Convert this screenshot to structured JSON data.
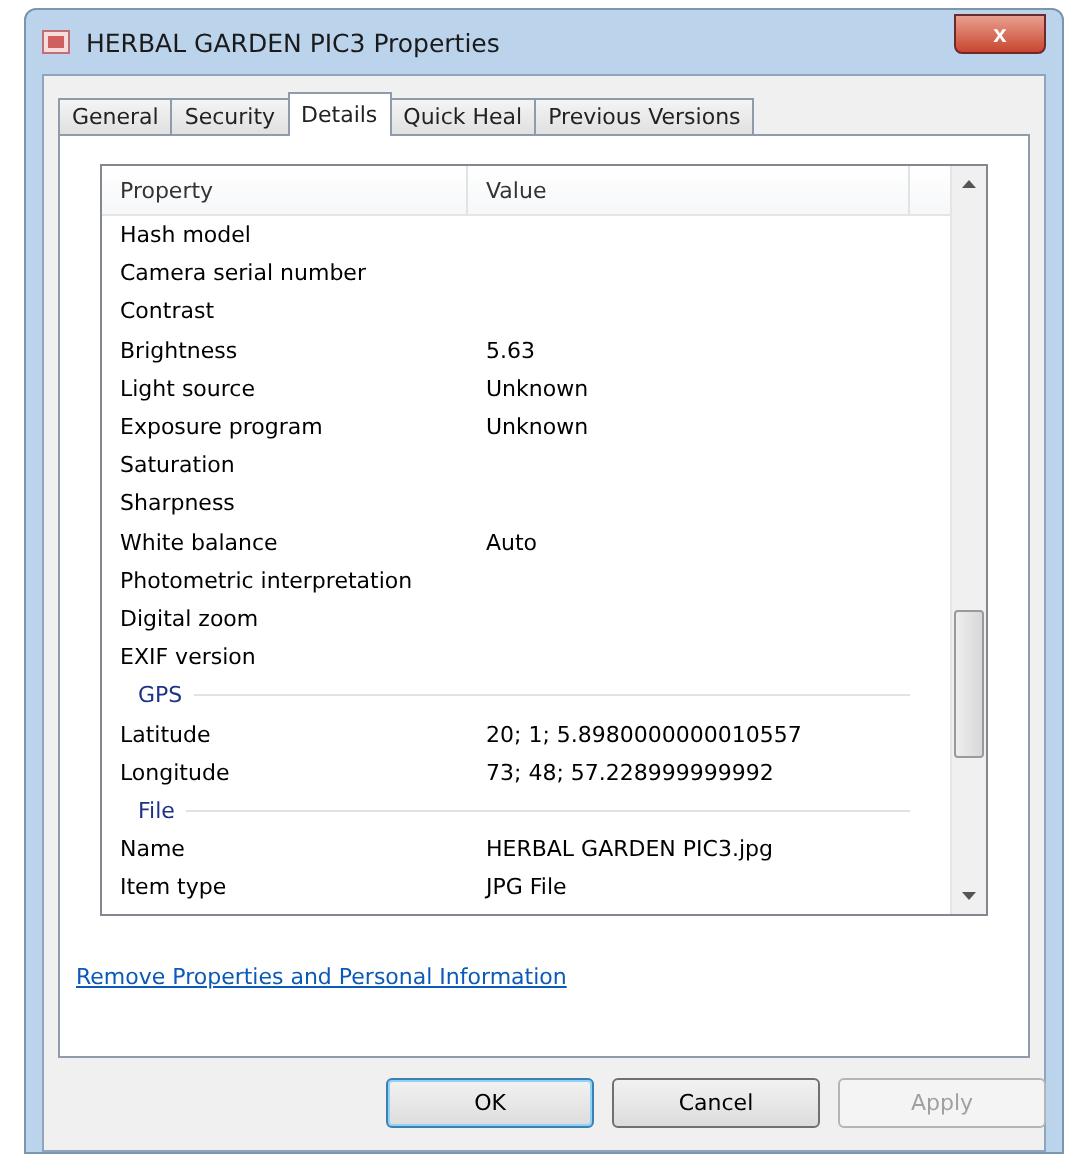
{
  "window": {
    "title": "HERBAL GARDEN PIC3 Properties",
    "close": "x"
  },
  "tabs": [
    {
      "label": "General",
      "selected": false
    },
    {
      "label": "Security",
      "selected": false
    },
    {
      "label": "Details",
      "selected": true
    },
    {
      "label": "Quick Heal",
      "selected": false
    },
    {
      "label": "Previous Versions",
      "selected": false
    }
  ],
  "table": {
    "columns": [
      "Property",
      "Value"
    ],
    "rows": [
      {
        "kind": "row",
        "property": "Hash model"
      },
      {
        "kind": "row",
        "property": "Camera serial number"
      },
      {
        "kind": "row",
        "property": "Contrast"
      },
      {
        "kind": "row",
        "property": "Brightness",
        "value": "5.63"
      },
      {
        "kind": "row",
        "property": "Light source",
        "value": "Unknown"
      },
      {
        "kind": "row",
        "property": "Exposure program",
        "value": "Unknown"
      },
      {
        "kind": "row",
        "property": "Saturation"
      },
      {
        "kind": "row",
        "property": "Sharpness"
      },
      {
        "kind": "row",
        "property": "White balance",
        "value": "Auto"
      },
      {
        "kind": "row",
        "property": "Photometric interpretation"
      },
      {
        "kind": "row",
        "property": "Digital zoom"
      },
      {
        "kind": "row",
        "property": "EXIF version"
      },
      {
        "kind": "group",
        "property": "GPS"
      },
      {
        "kind": "row",
        "property": "Latitude",
        "value": "20; 1; 5.8980000000010557"
      },
      {
        "kind": "row",
        "property": "Longitude",
        "value": "73; 48; 57.228999999992"
      },
      {
        "kind": "group",
        "property": "File"
      },
      {
        "kind": "row",
        "property": "Name",
        "value": "HERBAL GARDEN PIC3.jpg"
      },
      {
        "kind": "row",
        "property": "Item type",
        "value": "JPG File"
      }
    ]
  },
  "link": "Remove Properties and Personal Information",
  "buttons": [
    {
      "label": "OK",
      "default": true,
      "disabled": false
    },
    {
      "label": "Cancel",
      "default": false,
      "disabled": false
    },
    {
      "label": "Apply",
      "default": false,
      "disabled": true
    }
  ]
}
